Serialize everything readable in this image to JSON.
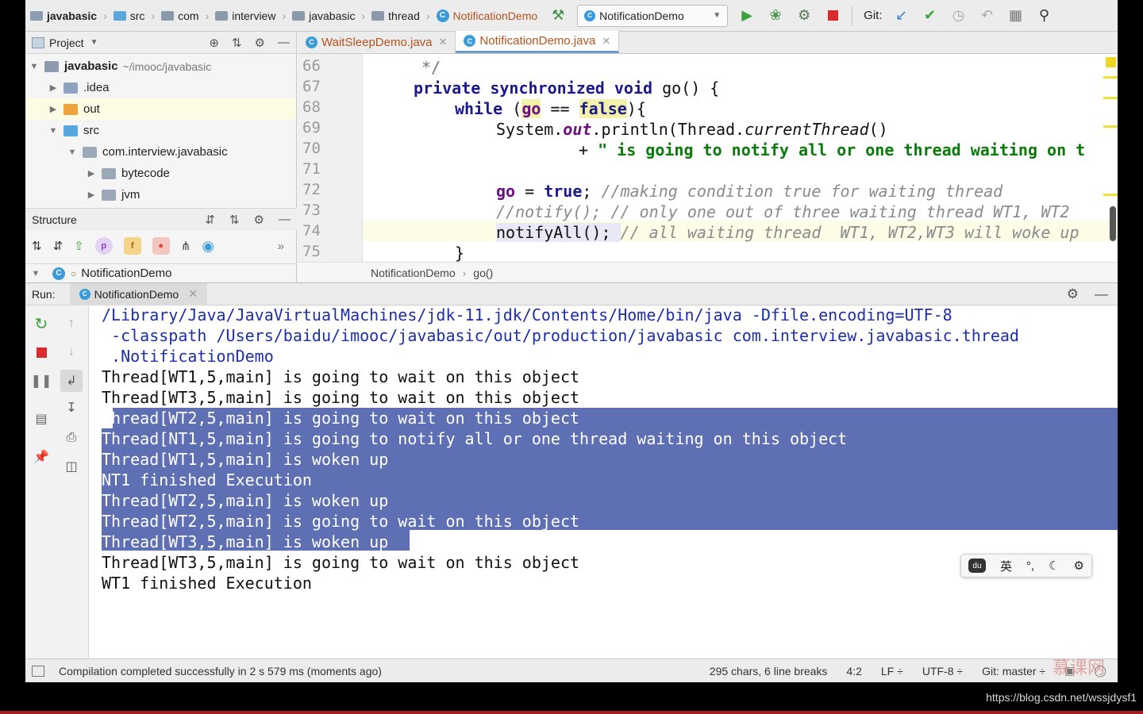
{
  "navbar": {
    "breadcrumbs": [
      "javabasic",
      "src",
      "com",
      "interview",
      "javabasic",
      "thread"
    ],
    "class_name": "NotificationDemo",
    "run_config": "NotificationDemo",
    "git_label": "Git:"
  },
  "project_pane": {
    "title": "Project",
    "tree": [
      {
        "label": "javabasic",
        "path": "~/imooc/javabasic"
      },
      {
        "label": ".idea"
      },
      {
        "label": "out"
      },
      {
        "label": "src"
      },
      {
        "label": "com.interview.javabasic"
      },
      {
        "label": "bytecode"
      },
      {
        "label": "jvm"
      }
    ]
  },
  "structure_pane": {
    "title": "Structure",
    "chips": [
      "p",
      "f"
    ],
    "item": "NotificationDemo"
  },
  "editor": {
    "tabs": [
      {
        "label": "WaitSleepDemo.java"
      },
      {
        "label": "NotificationDemo.java"
      }
    ],
    "line_numbers": [
      "66",
      "67",
      "68",
      "69",
      "70",
      "71",
      "72",
      "73",
      "74",
      "75"
    ],
    "code": {
      "l66": "*/",
      "l67_kw": "private synchronized void",
      "l67_rest": " go() {",
      "l68_kw": "while",
      "l68_open": " (",
      "l68_field": "go",
      "l68_op": " == ",
      "l68_false": "false",
      "l68_close": "){",
      "l69_a": "System.",
      "l69_out": "out",
      "l69_b": ".println(Thread.",
      "l69_cur": "currentThread",
      "l69_c": "()",
      "l70_plus": "+ ",
      "l70_str": "\" is going to notify all or one thread waiting on t",
      "l72_field": "go",
      "l72_eq": " = ",
      "l72_true": "true",
      "l72_semi": "; ",
      "l72_cmt": "//making condition true for waiting thread",
      "l73_cmt": "//notify(); // only one out of three waiting thread WT1, WT2",
      "l74_code": "notifyAll(); ",
      "l74_cmt": "// all waiting thread  WT1, WT2,WT3 will woke up",
      "l75": "}"
    },
    "breadcrumb": [
      "NotificationDemo",
      "go()"
    ]
  },
  "run": {
    "label": "Run:",
    "tab": "NotificationDemo",
    "console": [
      "/Library/Java/JavaVirtualMachines/jdk-11.jdk/Contents/Home/bin/java -Dfile.encoding=UTF-8",
      " -classpath /Users/baidu/imooc/javabasic/out/production/javabasic com.interview.javabasic.thread",
      " .NotificationDemo",
      "Thread[WT1,5,main] is going to wait on this object",
      "Thread[WT3,5,main] is going to wait on this object",
      "Thread[WT2,5,main] is going to wait on this object",
      "Thread[NT1,5,main] is going to notify all or one thread waiting on this object",
      "Thread[WT1,5,main] is woken up",
      "NT1 finished Execution",
      "Thread[WT2,5,main] is woken up",
      "Thread[WT2,5,main] is going to wait on this object",
      "Thread[WT3,5,main] is woken up",
      "Thread[WT3,5,main] is going to wait on this object",
      "WT1 finished Execution"
    ]
  },
  "ime": {
    "lang": "英",
    "punct": "°,"
  },
  "status": {
    "message": "Compilation completed successfully in 2 s 579 ms (moments ago)",
    "chars": "295 chars, 6 line breaks",
    "position": "4:2",
    "line_sep": "LF ÷",
    "encoding": "UTF-8 ÷",
    "git": "Git: master ÷"
  },
  "watermark": "慕课网",
  "url": "https://blog.csdn.net/wssjdysf1"
}
